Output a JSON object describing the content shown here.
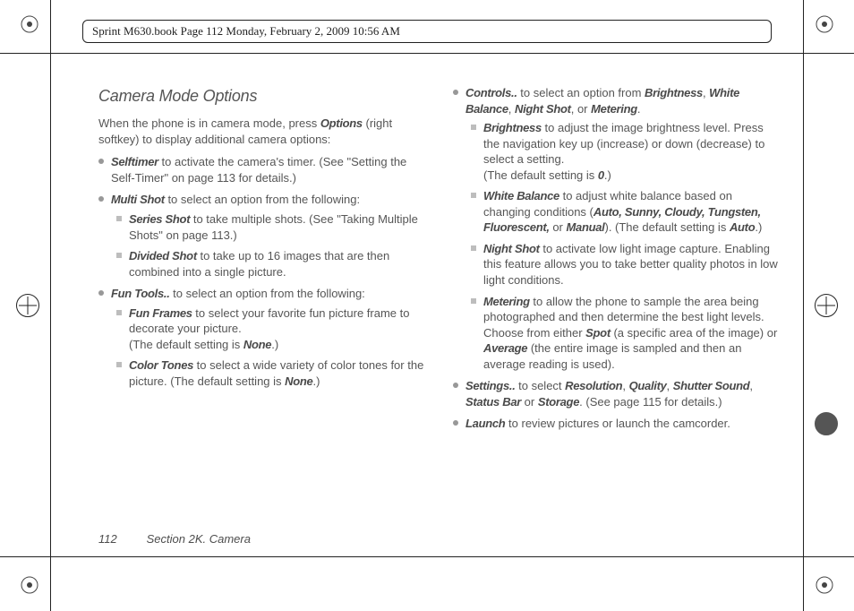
{
  "header": "Sprint M630.book  Page 112  Monday, February 2, 2009  10:56 AM",
  "title": "Camera Mode Options",
  "intro_a": "When the phone is in camera mode, press ",
  "intro_opt": "Options",
  "intro_b": " (right softkey) to display additional camera options:",
  "left": {
    "selftimer": {
      "head": "Selftimer",
      "body": "  to activate the camera's timer. (See \"Setting the Self-Timer\" on page 113 for details.)"
    },
    "multishot": {
      "head": "Multi Shot",
      "body": "  to select an option from the following:"
    },
    "series": {
      "head": "Series Shot",
      "body": " to take multiple shots. (See \"Taking Multiple Shots\" on page 113.)"
    },
    "divided": {
      "head": "Divided Shot",
      "body": " to take up to 16 images that are then combined into a single picture."
    },
    "funtools": {
      "head": "Fun Tools..",
      "body": " to select an option from the following:"
    },
    "funframes": {
      "head": "Fun Frames",
      "body": " to select your favorite fun picture frame to decorate your picture.",
      "def_a": "(The default setting is ",
      "def_v": "None",
      "def_b": ".)"
    },
    "colortones": {
      "head": "Color Tones",
      "body": " to select a wide variety of color tones for the picture. (The default setting is ",
      "def_v": "None",
      "def_b": ".)"
    }
  },
  "right": {
    "controls": {
      "head": "Controls..",
      "body_a": " to select an option from ",
      "o1": "Brightness",
      "sep1": ", ",
      "o2": "White Balance",
      "sep2": ", ",
      "o3": "Night Shot",
      "sep3": ", or ",
      "o4": "Metering",
      "end": "."
    },
    "brightness": {
      "head": "Brightness",
      "body": " to adjust the image brightness level. Press the navigation key up (increase) or down (decrease) to select a setting.",
      "def_a": "(The default setting is ",
      "def_v": "0",
      "def_b": ".)"
    },
    "wb": {
      "head": "White Balance",
      "body_a": " to adjust white balance based on changing conditions (",
      "opts": "Auto, Sunny, Cloudy, Tungsten, Fluorescent,",
      "or": " or ",
      "man": "Manual",
      "body_b": "). (The default setting is ",
      "def_v": "Auto",
      "def_b": ".)"
    },
    "night": {
      "head": "Night Shot",
      "body": " to activate low light image capture. Enabling this feature allows you to take better quality photos in low light conditions."
    },
    "metering": {
      "head": "Metering",
      "body_a": " to allow the phone to sample the area being photographed and then determine the best light levels. Choose from either ",
      "spot": "Spot",
      "body_b": " (a specific area of the image) or ",
      "avg": "Average",
      "body_c": " (the entire image is sampled and then an average reading is used)."
    },
    "settings": {
      "head": "Settings..",
      "body_a": " to select ",
      "o1": "Resolution",
      "s1": ", ",
      "o2": "Quality",
      "s2": ", ",
      "o3": "Shutter Sound",
      "s3": ", ",
      "o4": "Status Bar",
      "or": " or ",
      "o5": "Storage",
      "body_b": ". (See page 115 for details.)"
    },
    "launch": {
      "head": "Launch",
      "body": " to review pictures or launch the camcorder."
    }
  },
  "footer": {
    "page": "112",
    "section": "Section 2K. Camera"
  }
}
